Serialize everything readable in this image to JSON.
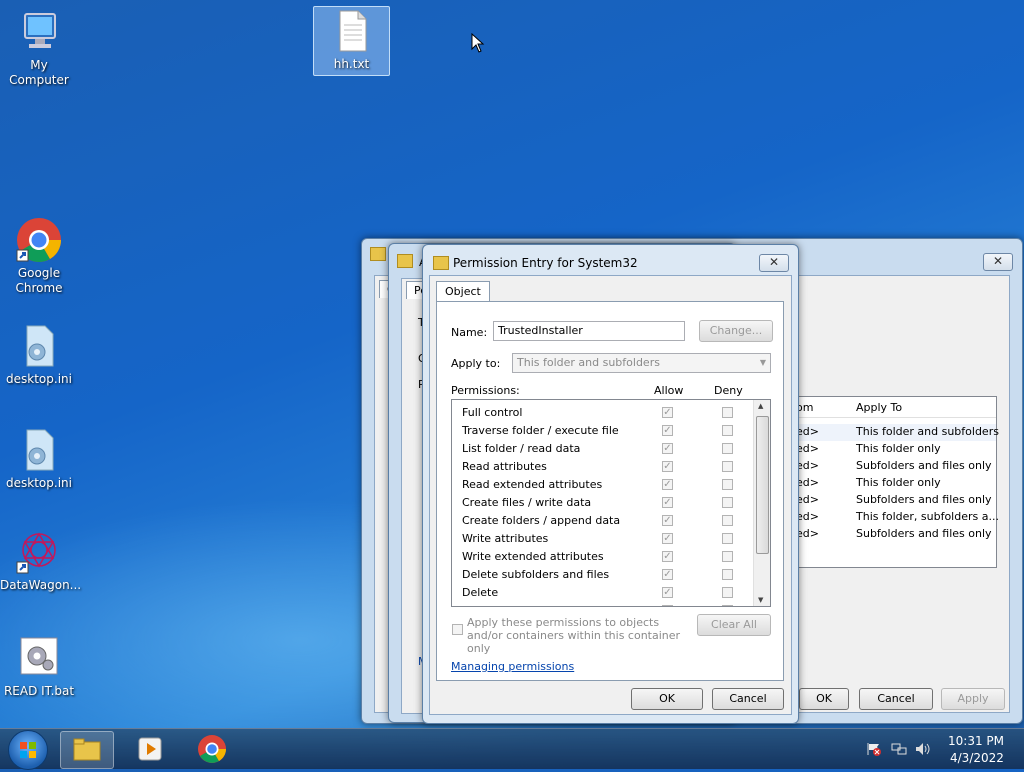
{
  "desktop": {
    "icons": [
      {
        "label": "My Computer"
      },
      {
        "label": "hh.txt"
      },
      {
        "label": "Google Chrome"
      },
      {
        "label": "desktop.ini"
      },
      {
        "label": "desktop.ini"
      },
      {
        "label": "DataWagon..."
      },
      {
        "label": "READ IT.bat"
      }
    ]
  },
  "back_window": {
    "tab_letter": "G",
    "columns": [
      "om",
      "Apply To"
    ],
    "rows": [
      {
        "from": "ed>",
        "apply_to": "This folder and subfolders"
      },
      {
        "from": "ed>",
        "apply_to": "This folder only"
      },
      {
        "from": "ed>",
        "apply_to": "Subfolders and files only"
      },
      {
        "from": "ed>",
        "apply_to": "This folder only"
      },
      {
        "from": "ed>",
        "apply_to": "Subfolders and files only"
      },
      {
        "from": "ed>",
        "apply_to": "This folder, subfolders a..."
      },
      {
        "from": "ed>",
        "apply_to": "Subfolders and files only"
      }
    ],
    "ok_label": "OK",
    "cancel_label": "Cancel",
    "apply_label": "Apply"
  },
  "middle_window": {
    "title_letter": "A",
    "tab_label": "Pe",
    "fragments": [
      "T",
      "O",
      "P",
      "M"
    ]
  },
  "dialog": {
    "title": "Permission Entry for System32",
    "tab": "Object",
    "name_label": "Name:",
    "name_value": "TrustedInstaller",
    "change_label": "Change...",
    "apply_to_label": "Apply to:",
    "apply_to_value": "This folder and subfolders",
    "permissions_label": "Permissions:",
    "allow_label": "Allow",
    "deny_label": "Deny",
    "permissions": [
      "Full control",
      "Traverse folder / execute file",
      "List folder / read data",
      "Read attributes",
      "Read extended attributes",
      "Create files / write data",
      "Create folders / append data",
      "Write attributes",
      "Write extended attributes",
      "Delete subfolders and files",
      "Delete"
    ],
    "apply_container_text": "Apply these permissions to objects and/or containers within this container only",
    "clear_all_label": "Clear All",
    "managing_link": "Managing permissions",
    "ok_label": "OK",
    "cancel_label": "Cancel"
  },
  "taskbar": {
    "time": "10:31 PM",
    "date": "4/3/2022"
  }
}
